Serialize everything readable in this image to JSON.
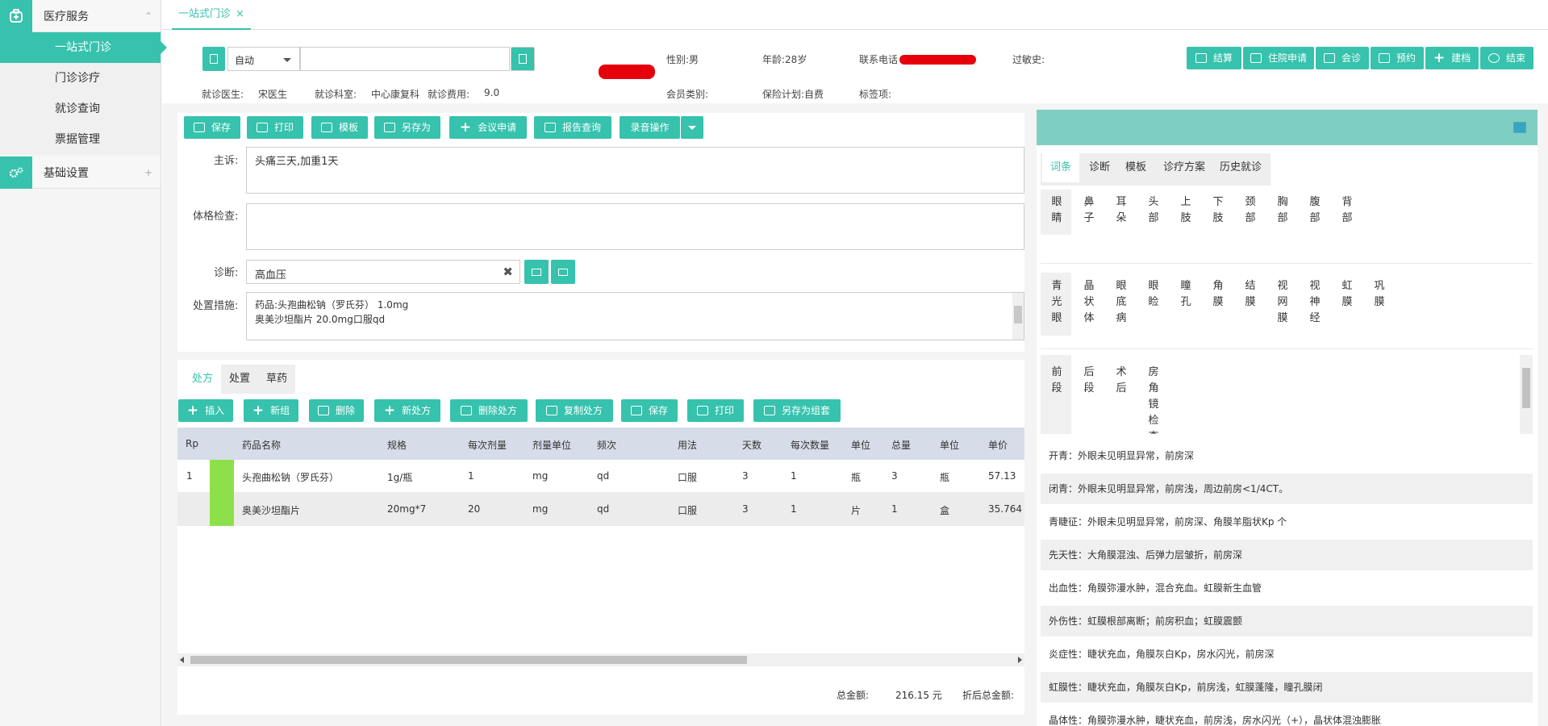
{
  "sidebar": {
    "groups": [
      {
        "label": "医疗服务",
        "icon": "medical-kit-icon"
      },
      {
        "label": "基础设置",
        "icon": "gears-icon"
      }
    ],
    "items": [
      {
        "label": "一站式门诊"
      },
      {
        "label": "门诊诊疗"
      },
      {
        "label": "就诊查询"
      },
      {
        "label": "票据管理"
      }
    ]
  },
  "tab": {
    "label": "一站式门诊",
    "close": "×"
  },
  "header": {
    "select_value": "自动",
    "gender": "性别:男",
    "age": "年龄:28岁",
    "phone": "联系电话",
    "allergy": "过敏史:",
    "doctor_label": "就诊医生:",
    "doctor": "宋医生",
    "dept_label": "就诊科室:",
    "dept": "中心康复科",
    "fee_label": "就诊费用:",
    "fee": "9.0",
    "member": "会员类别:",
    "insurance": "保险计划:自费",
    "tags": "标签项:"
  },
  "actions": [
    "结算",
    "住院申请",
    "会诊",
    "预约",
    "建档",
    "结束"
  ],
  "toolbar": [
    "保存",
    "打印",
    "模板",
    "另存为",
    "会议申请",
    "报告查询",
    "录音操作"
  ],
  "form": {
    "complaint_label": "主诉:",
    "complaint": "头痛三天,加重1天",
    "exam_label": "体格检查:",
    "diag_label": "诊断:",
    "diag": "高血压",
    "treat_label": "处置措施:",
    "treat1": "药品:头孢曲松钠（罗氏芬） 1.0mg",
    "treat2": "奥美沙坦酯片 20.0mg口服qd"
  },
  "presc_tabs": [
    "处方",
    "处置",
    "草药"
  ],
  "presc_toolbar": [
    "插入",
    "新组",
    "删除",
    "新处方",
    "删除处方",
    "复制处方",
    "保存",
    "打印",
    "另存为组套"
  ],
  "table": {
    "headers": [
      "Rp",
      "",
      "药品名称",
      "规格",
      "每次剂量",
      "剂量单位",
      "频次",
      "用法",
      "天数",
      "每次数量",
      "单位",
      "总量",
      "单位",
      "单价"
    ],
    "rows": [
      [
        "1",
        "",
        "头孢曲松钠（罗氏芬）",
        "1g/瓶",
        "1",
        "mg",
        "qd",
        "口服",
        "3",
        "1",
        "瓶",
        "3",
        "瓶",
        "57.13"
      ],
      [
        "",
        "",
        "奥美沙坦酯片",
        "20mg*7",
        "20",
        "mg",
        "qd",
        "口服",
        "3",
        "1",
        "片",
        "1",
        "盒",
        "35.764"
      ]
    ]
  },
  "totals": {
    "label": "总金额:",
    "value": "216.15 元",
    "discount": "折后总金额:"
  },
  "right": {
    "tabs": [
      "词条",
      "诊断",
      "模板",
      "诊疗方案",
      "历史就诊"
    ],
    "row1": [
      "眼睛",
      "鼻子",
      "耳朵",
      "头部",
      "上肢",
      "下肢",
      "颈部",
      "胸部",
      "腹部",
      "背部"
    ],
    "row2": [
      "青光眼",
      "晶状体",
      "眼底病",
      "眼睑",
      "瞳孔",
      "角膜",
      "结膜",
      "视网膜",
      "视神经",
      "虹膜",
      "巩膜"
    ],
    "row3": [
      "前段",
      "后段",
      "术后",
      "房角镜检查"
    ],
    "statements": [
      "开青：外眼未见明显异常，前房深",
      "闭青：外眼未见明显异常，前房浅，周边前房<1/4CT。",
      "青睫征：外眼未见明显异常，前房深、角膜羊脂状Kp 个",
      "先天性：大角膜混浊、后弹力层皱折，前房深",
      "出血性：角膜弥漫水肿，混合充血。虹膜新生血管",
      "外伤性：虹膜根部离断；前房积血；虹膜震颤",
      "炎症性：睫状充血，角膜灰白Kp，房水闪光，前房深",
      "虹膜性：睫状充血，角膜灰白Kp，前房浅，虹膜蓬隆，瞳孔膜闭",
      "晶体性：角膜弥漫水肿，睫状充血，前房浅，房水闪光（+），晶状体混浊膨胀"
    ]
  },
  "colors": {
    "accent": "#36c2ad",
    "header_row": "#d6dde9",
    "drug_marker": "#8ee04a"
  }
}
